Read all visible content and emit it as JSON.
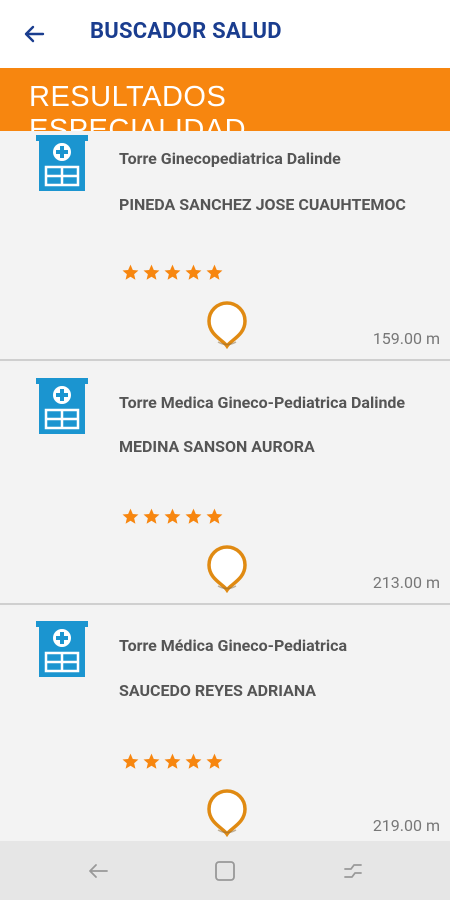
{
  "header": {
    "title": "BUSCADOR SALUD",
    "back_icon": "back-arrow-icon",
    "title_color": "#1a3d8f"
  },
  "banner": {
    "title": "RESULTADOS ESPECIALIDAD",
    "color": "#f7860f"
  },
  "results": [
    {
      "place": "Torre Ginecopediatrica Dalinde",
      "doctor": "PINEDA SANCHEZ JOSE CUAUHTEMOC",
      "rating": 5,
      "distance": "159.00 m"
    },
    {
      "place": "Torre Medica Gineco-Pediatrica Dalinde",
      "doctor": "MEDINA SANSON AURORA",
      "rating": 5,
      "distance": "213.00 m"
    },
    {
      "place": "Torre Médica Gineco-Pediatrica",
      "doctor": "SAUCEDO REYES ADRIANA",
      "rating": 5,
      "distance": "219.00 m"
    }
  ],
  "colors": {
    "hospital_icon": "#1b95d0",
    "star": "#f7860f",
    "pin": "#e08a12"
  },
  "navbar": {
    "back_icon": "nav-back-icon",
    "home_icon": "nav-home-icon",
    "recents_icon": "nav-recents-icon"
  }
}
